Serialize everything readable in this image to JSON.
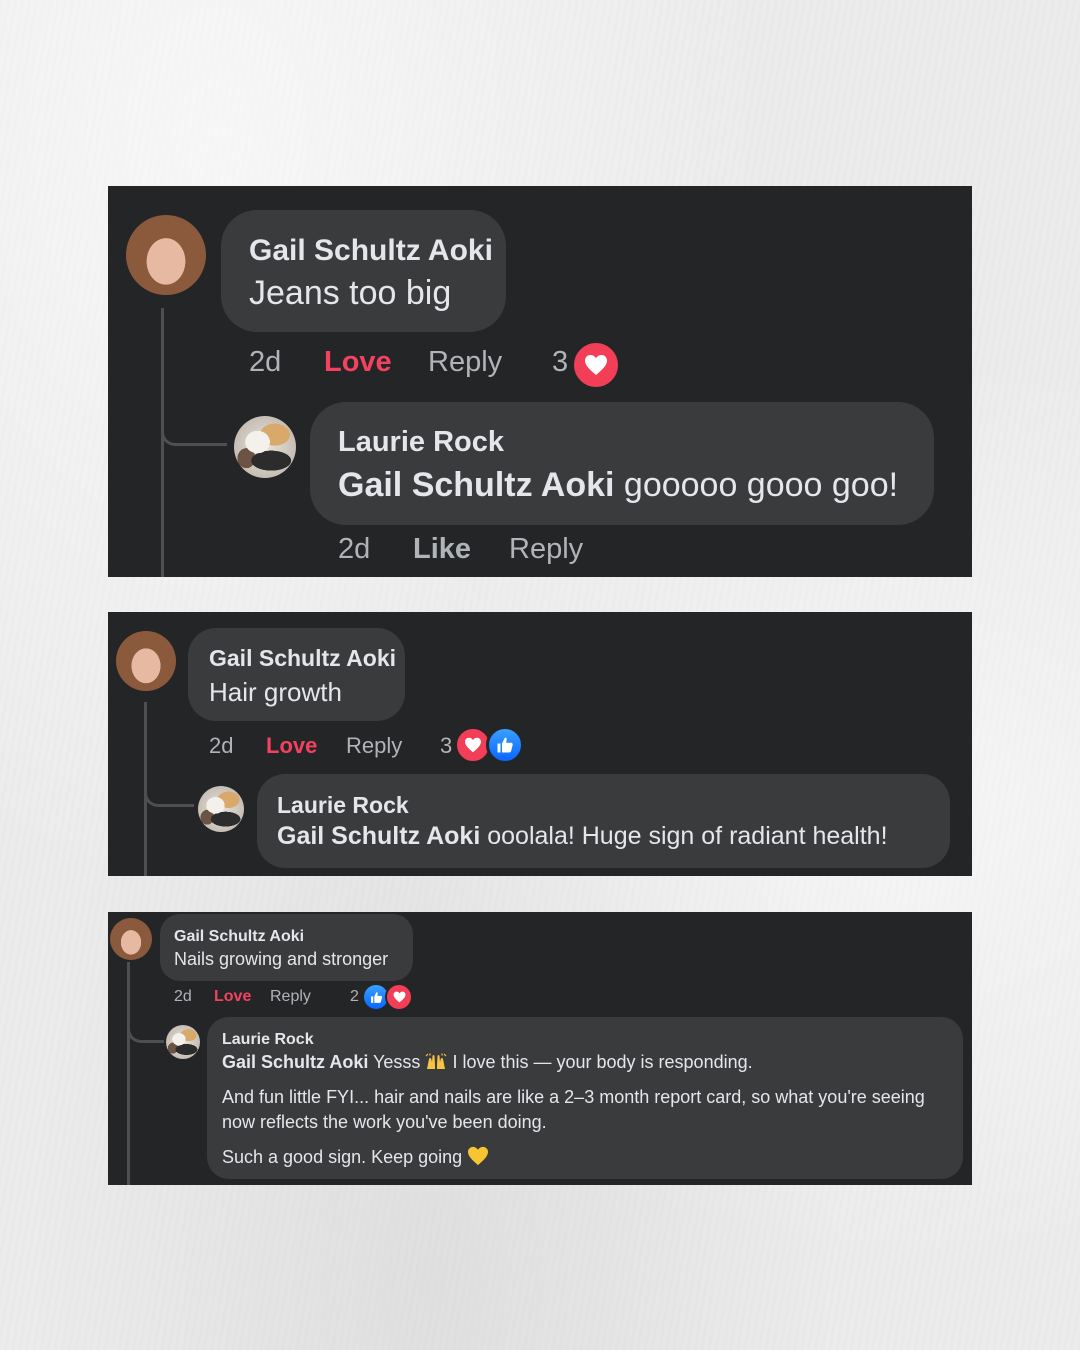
{
  "colors": {
    "card_bg": "#242526",
    "bubble_bg": "#3a3b3c",
    "text": "#e4e6eb",
    "meta_text": "#b0b3b8",
    "love": "#f3425f",
    "like_blue": "#1877f2"
  },
  "cards": [
    {
      "comment": {
        "author": "Gail Schultz Aoki",
        "text": "Jeans too big",
        "time": "2d",
        "reaction_action": "Love",
        "reply_action": "Reply",
        "reaction_count": "3",
        "reaction_icons": [
          "love-icon"
        ]
      },
      "reply": {
        "author": "Laurie Rock",
        "mention": "Gail Schultz Aoki",
        "text": "gooooo gooo goo!",
        "time": "2d",
        "reaction_action": "Like",
        "reply_action": "Reply"
      }
    },
    {
      "comment": {
        "author": "Gail Schultz Aoki",
        "text": "Hair growth",
        "time": "2d",
        "reaction_action": "Love",
        "reply_action": "Reply",
        "reaction_count": "3",
        "reaction_icons": [
          "love-icon",
          "like-icon"
        ]
      },
      "reply": {
        "author": "Laurie Rock",
        "mention": "Gail Schultz Aoki",
        "text": "ooolala! Huge sign of radiant health!"
      }
    },
    {
      "comment": {
        "author": "Gail Schultz Aoki",
        "text": "Nails growing and stronger",
        "time": "2d",
        "reaction_action": "Love",
        "reply_action": "Reply",
        "reaction_count": "2",
        "reaction_icons": [
          "like-icon",
          "love-icon"
        ]
      },
      "reply": {
        "author": "Laurie Rock",
        "mention": "Gail Schultz Aoki",
        "line1_a": "Yesss",
        "line1_emoji": "raising-hands-icon",
        "line1_b": "I love this — your body is responding.",
        "para2_line1": "And fun little FYI... hair and nails are like a 2–3 month report card, so what you're seeing",
        "para2_line2": "now reflects the work you've been doing.",
        "para3": "Such a good sign. Keep going",
        "para3_emoji": "yellow-heart-icon"
      }
    }
  ]
}
